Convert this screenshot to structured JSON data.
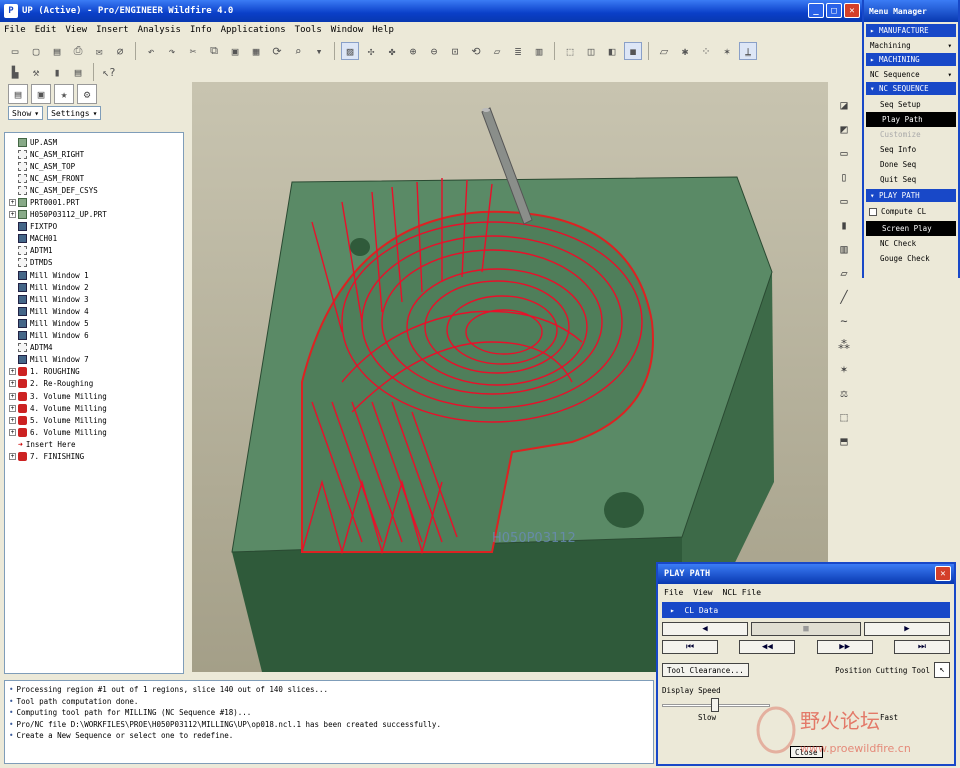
{
  "window": {
    "title": "UP (Active) - Pro/ENGINEER Wildfire 4.0"
  },
  "menubar": {
    "items": [
      "File",
      "Edit",
      "View",
      "Insert",
      "Analysis",
      "Info",
      "Applications",
      "Tools",
      "Window",
      "Help"
    ]
  },
  "left": {
    "show_label": "Show",
    "settings_label": "Settings",
    "tree": [
      {
        "label": "UP.ASM",
        "icon": "part",
        "exp": ""
      },
      {
        "label": "NC_ASM_RIGHT",
        "icon": "plane",
        "exp": ""
      },
      {
        "label": "NC_ASM_TOP",
        "icon": "plane",
        "exp": ""
      },
      {
        "label": "NC_ASM_FRONT",
        "icon": "plane",
        "exp": ""
      },
      {
        "label": "NC_ASM_DEF_CSYS",
        "icon": "plane",
        "exp": ""
      },
      {
        "label": "PRT0001.PRT",
        "icon": "part",
        "exp": "+"
      },
      {
        "label": "H050P03112_UP.PRT",
        "icon": "part",
        "exp": "+"
      },
      {
        "label": "FIXTPO",
        "icon": "win",
        "exp": ""
      },
      {
        "label": "MACH01",
        "icon": "win",
        "exp": ""
      },
      {
        "label": "ADTM1",
        "icon": "plane",
        "exp": ""
      },
      {
        "label": "DTMDS",
        "icon": "plane",
        "exp": ""
      },
      {
        "label": "Mill Window 1",
        "icon": "win",
        "exp": ""
      },
      {
        "label": "Mill Window 2",
        "icon": "win",
        "exp": ""
      },
      {
        "label": "Mill Window 3",
        "icon": "win",
        "exp": ""
      },
      {
        "label": "Mill Window 4",
        "icon": "win",
        "exp": ""
      },
      {
        "label": "Mill Window 5",
        "icon": "win",
        "exp": ""
      },
      {
        "label": "Mill Window 6",
        "icon": "win",
        "exp": ""
      },
      {
        "label": "ADTM4",
        "icon": "plane",
        "exp": ""
      },
      {
        "label": "Mill Window 7",
        "icon": "win",
        "exp": ""
      },
      {
        "label": "1. ROUGHING",
        "icon": "seq",
        "exp": "+"
      },
      {
        "label": "2. Re-Roughing",
        "icon": "seq",
        "exp": "+"
      },
      {
        "label": "3. Volume Milling",
        "icon": "seq",
        "exp": "+"
      },
      {
        "label": "4. Volume Milling",
        "icon": "seq",
        "exp": "+"
      },
      {
        "label": "5. Volume Milling",
        "icon": "seq",
        "exp": "+"
      },
      {
        "label": "6. Volume Milling",
        "icon": "seq",
        "exp": "+"
      },
      {
        "label": "Insert Here",
        "icon": "arrow",
        "exp": ""
      },
      {
        "label": "7. FINISHING",
        "icon": "seq",
        "exp": "+"
      }
    ]
  },
  "messages": [
    "Processing region #1 out of 1 regions, slice 140 out of 140 slices...",
    "Tool path computation done.",
    "Computing tool path for MILLING (NC Sequence #18)...",
    "Pro/NC file D:\\WORKFILES\\PROE\\H050P03112\\MILLING\\UP\\op018.ncl.1 has been created successfully.",
    "Create a New Sequence or select one to redefine."
  ],
  "viewport": {
    "part_label": "H050P03112"
  },
  "menu_manager": {
    "title": "Menu Manager",
    "manufacture": "MANUFACTURE",
    "machining_drop": "Machining",
    "machining_head": "MACHINING",
    "nc_seq_drop": "NC Sequence",
    "nc_seq_head": "NC SEQUENCE",
    "items": [
      "Seq Setup",
      "Play Path",
      "Customize",
      "Seq Info",
      "Done Seq",
      "Quit Seq"
    ],
    "selected": "Play Path",
    "disabled": "Customize",
    "play_path_head": "PLAY PATH",
    "compute_cl": "Compute CL",
    "play_items": [
      "Screen Play",
      "NC Check",
      "Gouge Check"
    ],
    "play_selected": "Screen Play"
  },
  "play_path": {
    "title": "PLAY PATH",
    "menu": [
      "File",
      "View",
      "NCL File"
    ],
    "cl_data": "CL Data",
    "tool_clearance": "Tool Clearance...",
    "position_label": "Position Cutting Tool",
    "display_speed": "Display Speed",
    "slow": "Slow",
    "fast": "Fast",
    "close": "Close",
    "speed_level": 0.45
  },
  "watermark": {
    "cn": "野火论坛",
    "url": "www.proewildfire.cn"
  },
  "colors": {
    "titlebar": "#0a3fc8",
    "part_green": "#5a8a66",
    "toolpath": "#e8102a",
    "selected_bg": "#000000"
  }
}
